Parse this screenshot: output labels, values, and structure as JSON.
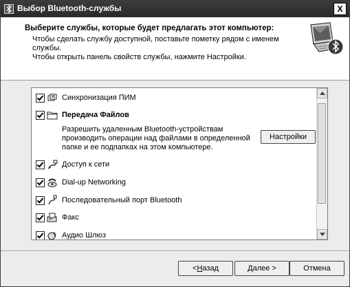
{
  "window": {
    "title": "Выбор Bluetooth-службы",
    "close_glyph": "X"
  },
  "header": {
    "title": "Выберите службы, которые будет предлагать этот компьютер:",
    "line1": "Чтобы сделать службу доступной, поставьте пометку рядом с именем",
    "line2": "службы.",
    "line3": "Чтобы открыть панель свойств службы, нажмите Настройки.",
    "image_icon": "computer-bluetooth-icon"
  },
  "services": [
    {
      "label": "Синхронизация ПИМ",
      "checked": true,
      "icon": "pim-sync-icon",
      "bold": false
    },
    {
      "label": "Передача Файлов",
      "checked": true,
      "icon": "folder-icon",
      "bold": true
    },
    {
      "label": "Доступ к сети",
      "checked": true,
      "icon": "network-access-icon",
      "bold": false
    },
    {
      "label": "Dial-up Networking",
      "checked": true,
      "icon": "dialup-icon",
      "bold": false
    },
    {
      "label": "Последовательный порт Bluetooth",
      "checked": true,
      "icon": "serial-port-icon",
      "bold": false
    },
    {
      "label": "Факс",
      "checked": true,
      "icon": "fax-icon",
      "bold": false
    },
    {
      "label": "Аудио Шлюз",
      "checked": true,
      "icon": "audio-gateway-icon",
      "bold": false
    }
  ],
  "selected_detail": {
    "desc1": "Разрешить удаленным Bluetooth-устройствам",
    "desc2": "производить операции над файлами в определенной",
    "desc3": "папке и ее подпапках на этом компьютере.",
    "settings_label": "Настройки"
  },
  "footer": {
    "back_prefix": "< ",
    "back_hot": "Н",
    "back_rest": "азад",
    "next_prefix": "",
    "next_hot": "Д",
    "next_rest": "алее >",
    "cancel_label": "Отмена"
  }
}
